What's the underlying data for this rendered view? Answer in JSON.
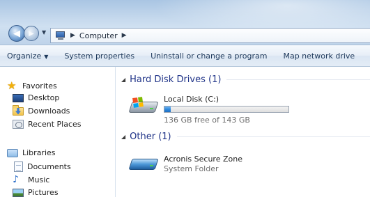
{
  "window": {
    "breadcrumb": [
      "Computer"
    ],
    "nav_back": "back",
    "nav_forward": "forward"
  },
  "toolbar": {
    "items": [
      {
        "label": "Organize",
        "has_menu": true
      },
      {
        "label": "System properties"
      },
      {
        "label": "Uninstall or change a program"
      },
      {
        "label": "Map network drive"
      }
    ]
  },
  "sidebar": {
    "favorites": {
      "label": "Favorites",
      "icon": "star-icon",
      "items": [
        {
          "label": "Desktop",
          "icon": "desktop-icon"
        },
        {
          "label": "Downloads",
          "icon": "downloads-folder-icon"
        },
        {
          "label": "Recent Places",
          "icon": "recent-places-icon"
        }
      ]
    },
    "libraries": {
      "label": "Libraries",
      "icon": "libraries-icon",
      "items": [
        {
          "label": "Documents",
          "icon": "documents-icon"
        },
        {
          "label": "Music",
          "icon": "music-icon"
        },
        {
          "label": "Pictures",
          "icon": "pictures-icon"
        }
      ]
    }
  },
  "content": {
    "groups": [
      {
        "header": "Hard Disk Drives (1)",
        "items": [
          {
            "name": "Local Disk (C:)",
            "detail": "136 GB free of 143 GB",
            "used_fraction": 0.049,
            "bar_color": "#2b86dc"
          }
        ]
      },
      {
        "header": "Other (1)",
        "items": [
          {
            "name": "Acronis Secure Zone",
            "detail": "System Folder"
          }
        ]
      }
    ]
  },
  "colors": {
    "group_header": "#1e3287",
    "toolbar_text": "#1e395b",
    "secondary_text": "#6d6d6d"
  }
}
